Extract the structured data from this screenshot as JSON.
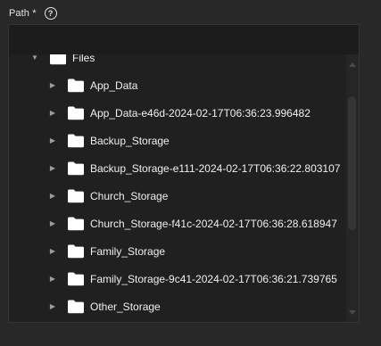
{
  "field": {
    "label": "Path",
    "required_mark": "*",
    "help_icon": "help-circle-icon",
    "value": "",
    "placeholder": ""
  },
  "tree": {
    "root": {
      "label": "Files",
      "expanded": true
    },
    "items": [
      {
        "label": "App_Data"
      },
      {
        "label": "App_Data-e46d-2024-02-17T06:36:23.996482"
      },
      {
        "label": "Backup_Storage"
      },
      {
        "label": "Backup_Storage-e111-2024-02-17T06:36:22.803107"
      },
      {
        "label": "Church_Storage"
      },
      {
        "label": "Church_Storage-f41c-2024-02-17T06:36:28.618947"
      },
      {
        "label": "Family_Storage"
      },
      {
        "label": "Family_Storage-9c41-2024-02-17T06:36:21.739765"
      },
      {
        "label": "Other_Storage"
      }
    ]
  },
  "icons": {
    "folder": "folder-icon",
    "collapsed": "chevron-right-icon",
    "expanded": "chevron-down-icon"
  },
  "colors": {
    "background": "#282828",
    "panel": "#202020",
    "input": "#1c1c1c",
    "folder": "#ffffff",
    "text": "#f0f0f0"
  }
}
